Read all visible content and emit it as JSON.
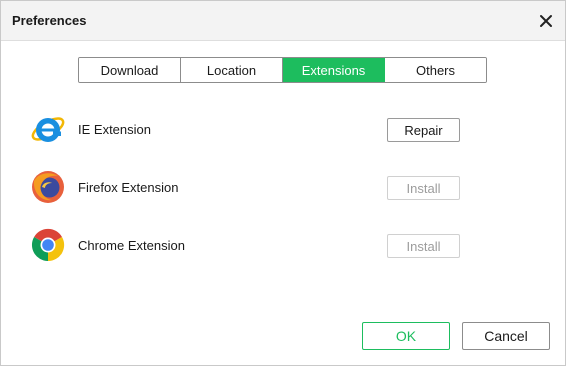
{
  "window": {
    "title": "Preferences"
  },
  "tabs": [
    {
      "label": "Download",
      "active": false
    },
    {
      "label": "Location",
      "active": false
    },
    {
      "label": "Extensions",
      "active": true
    },
    {
      "label": "Others",
      "active": false
    }
  ],
  "extensions": [
    {
      "name": "IE Extension",
      "icon": "internet-explorer-icon",
      "button": "Repair",
      "enabled": true
    },
    {
      "name": "Firefox Extension",
      "icon": "firefox-icon",
      "button": "Install",
      "enabled": false
    },
    {
      "name": "Chrome Extension",
      "icon": "chrome-icon",
      "button": "Install",
      "enabled": false
    }
  ],
  "footer": {
    "ok_label": "OK",
    "cancel_label": "Cancel"
  },
  "colors": {
    "accent": "#1dbd5e",
    "title_bar": "#f3f3f3",
    "disabled_text": "#9c9c9c"
  }
}
